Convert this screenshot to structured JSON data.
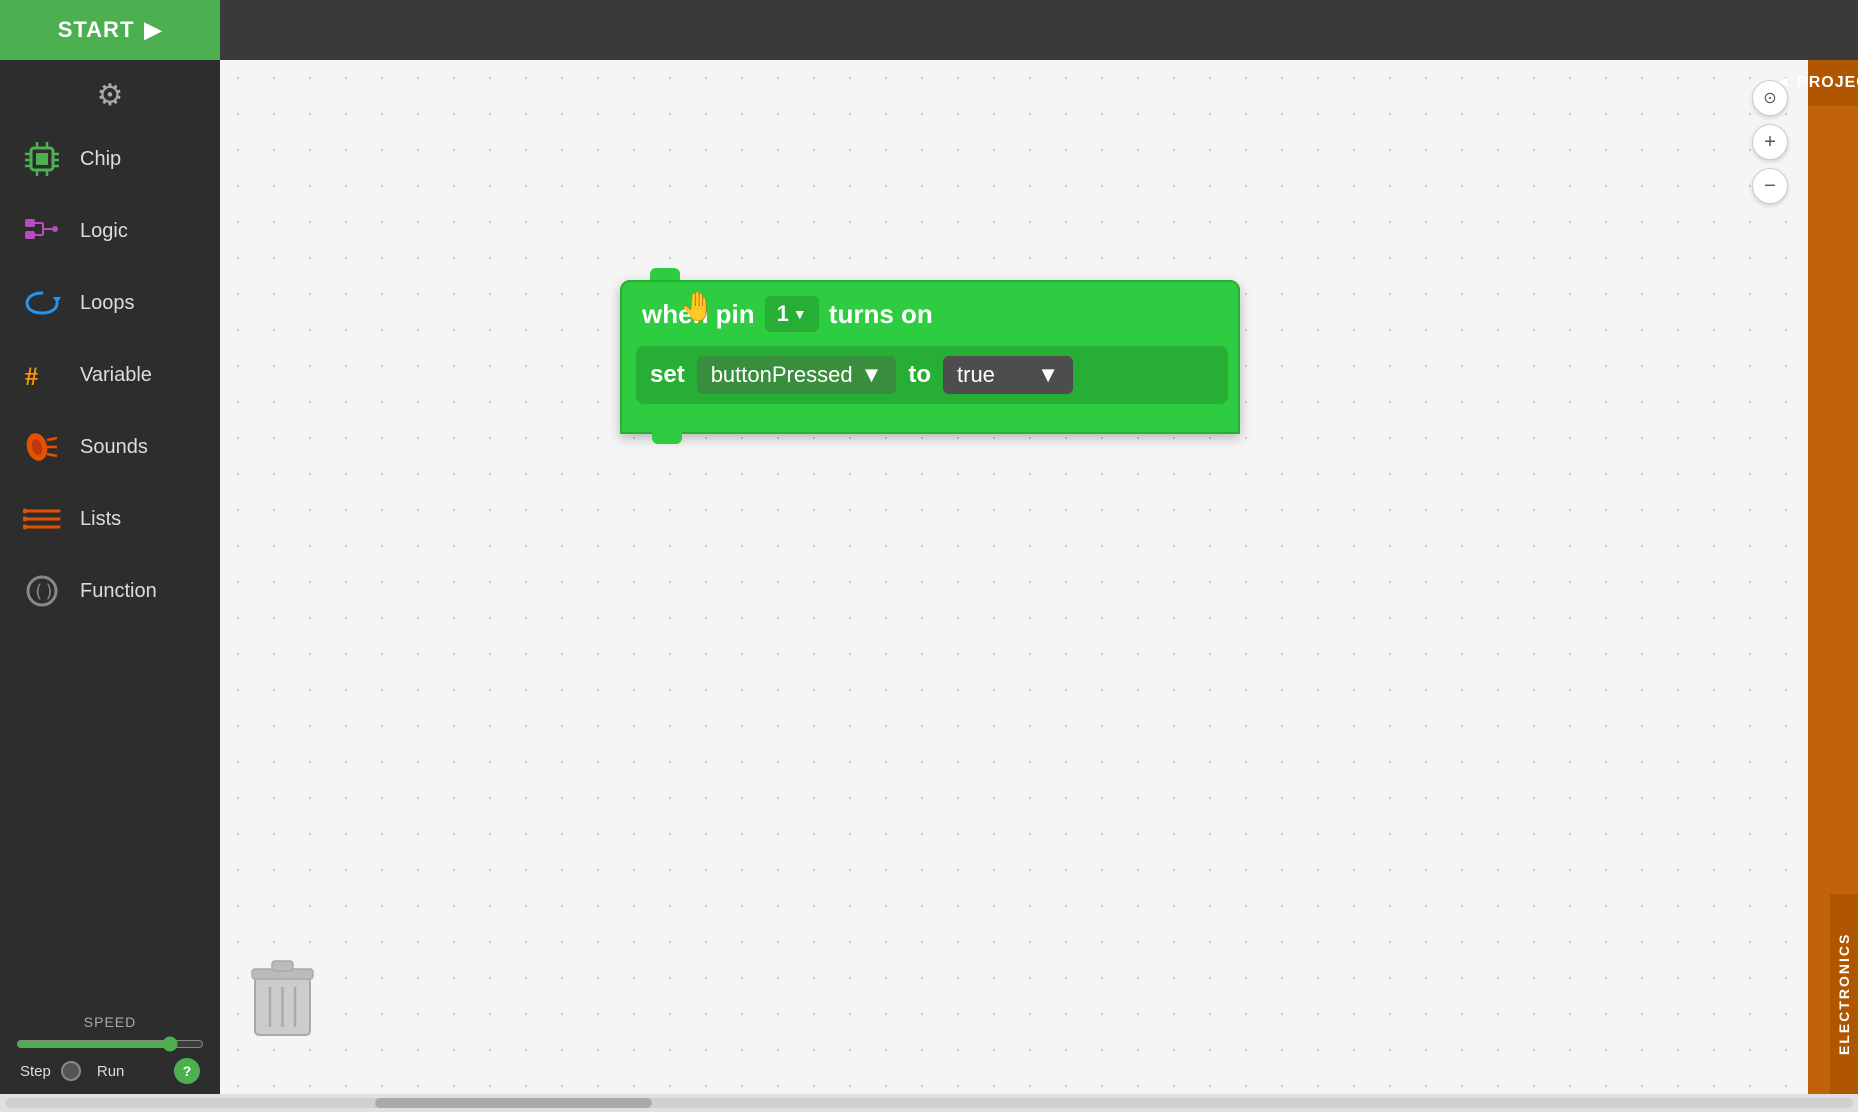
{
  "topbar": {
    "start_label": "START",
    "play_symbol": "▶"
  },
  "sidebar": {
    "gear_symbol": "⚙",
    "items": [
      {
        "id": "chip",
        "label": "Chip"
      },
      {
        "id": "logic",
        "label": "Logic"
      },
      {
        "id": "loops",
        "label": "Loops"
      },
      {
        "id": "variable",
        "label": "Variable"
      },
      {
        "id": "sounds",
        "label": "Sounds"
      },
      {
        "id": "lists",
        "label": "Lists"
      },
      {
        "id": "function",
        "label": "Function"
      }
    ],
    "speed_label": "SPEED",
    "step_label": "Step",
    "run_label": "Run",
    "help_symbol": "?"
  },
  "block": {
    "when_text": "when pin",
    "pin_value": "1",
    "turns_on_text": "turns on",
    "set_text": "set",
    "variable_name": "buttonPressed",
    "to_text": "to",
    "value": "true"
  },
  "zoom": {
    "target_symbol": "⊙",
    "plus_symbol": "+",
    "minus_symbol": "−"
  },
  "right_panel": {
    "projects_label": "◄ PROJECTS",
    "electronics_label": "ELECTRONICS"
  }
}
